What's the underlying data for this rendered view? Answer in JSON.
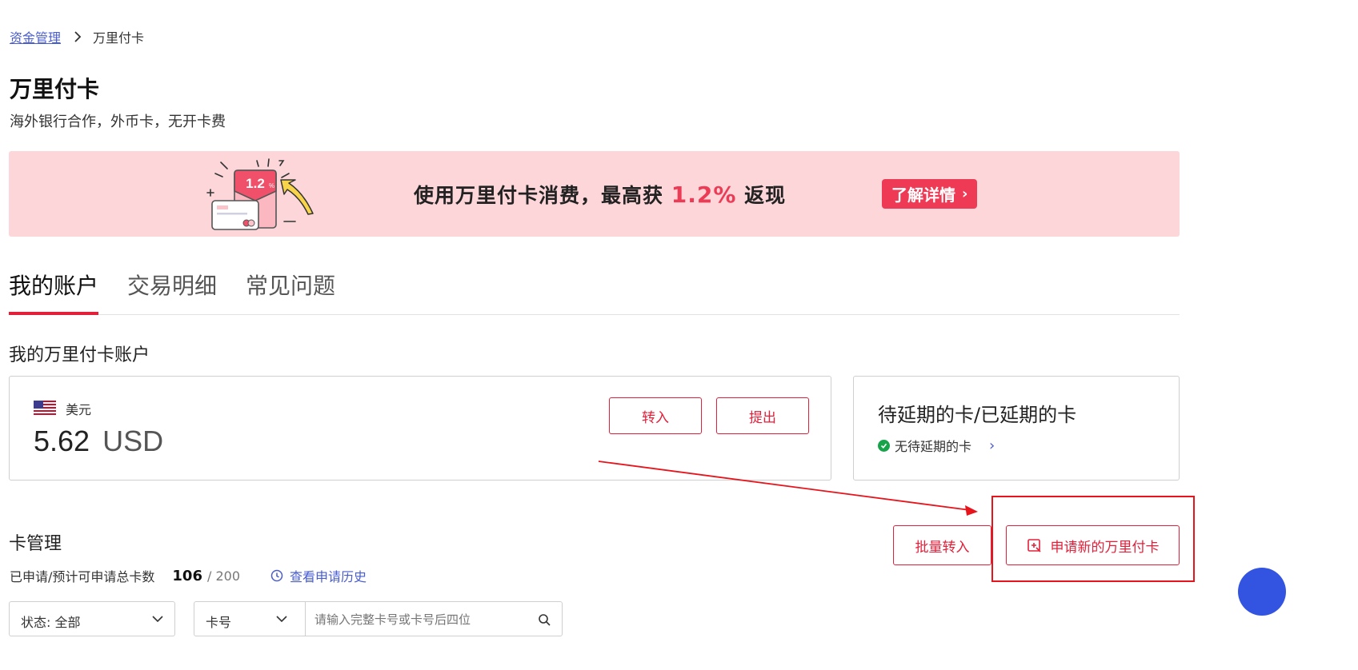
{
  "breadcrumb": {
    "parent": "资金管理",
    "current": "万里付卡"
  },
  "header": {
    "title": "万里付卡",
    "subtitle": "海外银行合作，外币卡，无开卡费"
  },
  "banner": {
    "illus_rate": "1.2",
    "illus_pct": "%",
    "text_before": "使用万里付卡消费，最高获",
    "text_highlight": "1.2%",
    "text_after": "返现",
    "button": "了解详情",
    "bg_color": "#fdd6da",
    "accent_color": "#ee3a55"
  },
  "tabs": [
    {
      "label": "我的账户",
      "active": true
    },
    {
      "label": "交易明细",
      "active": false
    },
    {
      "label": "常见问题",
      "active": false
    }
  ],
  "account_section": {
    "title": "我的万里付卡账户",
    "currency_name": "美元",
    "currency_flag": "us-flag-icon",
    "balance": "5.62",
    "unit": "USD",
    "transfer_in": "转入",
    "withdraw": "提出"
  },
  "extension": {
    "title": "待延期的卡/已延期的卡",
    "status": "无待延期的卡"
  },
  "card_mgmt": {
    "title": "卡管理",
    "batch_transfer": "批量转入",
    "apply_new": "申请新的万里付卡",
    "stat_label": "已申请/预计可申请总卡数",
    "applied": "106",
    "total": "/ 200",
    "history_link": "查看申请历史"
  },
  "filters": {
    "status_select": "状态: 全部",
    "card_select": "卡号",
    "card_placeholder": "请输入完整卡号或卡号后四位"
  },
  "colors": {
    "primary_red": "#e3203a",
    "link_blue": "#4a5dcc",
    "annotation_red": "#e8141c"
  }
}
